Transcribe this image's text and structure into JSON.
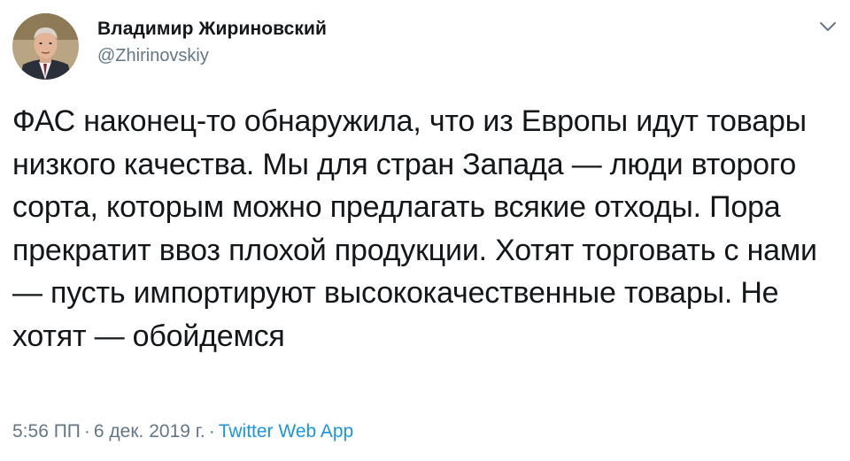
{
  "author": {
    "display_name": "Владимир Жириновский",
    "handle": "@Zhirinovskiy"
  },
  "tweet": {
    "text": "ФАС наконец-то обнаружила, что из Европы идут товары низкого качества. Мы для стран Запада — люди второго сорта, которым можно предлагать всякие отходы. Пора прекратит ввоз плохой продукции. Хотят торговать с нами — пусть импортируют высококачественные товары. Не хотят — обойдемся"
  },
  "meta": {
    "time": "5:56 ПП",
    "separator": "·",
    "date": "6 дек. 2019 г.",
    "source": "Twitter Web App"
  },
  "colors": {
    "text": "#14171a",
    "secondary": "#657786",
    "link": "#1b95e0"
  },
  "icons": {
    "menu": "chevron-down-icon"
  }
}
